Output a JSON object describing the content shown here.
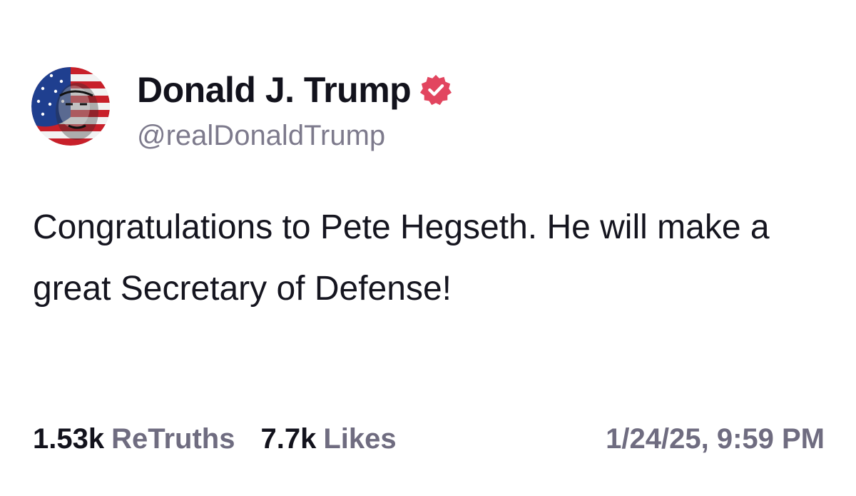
{
  "author": {
    "display_name": "Donald J. Trump",
    "handle": "@realDonaldTrump",
    "verified_badge_icon": "verified-check-icon",
    "badge_color": "#e2455f"
  },
  "post": {
    "text": "Congratulations to Pete Hegseth. He will make a great Secretary of Defense!"
  },
  "stats": {
    "retruths": {
      "count": "1.53k",
      "label": "ReTruths"
    },
    "likes": {
      "count": "7.7k",
      "label": "Likes"
    },
    "timestamp": "1/24/25, 9:59 PM"
  }
}
